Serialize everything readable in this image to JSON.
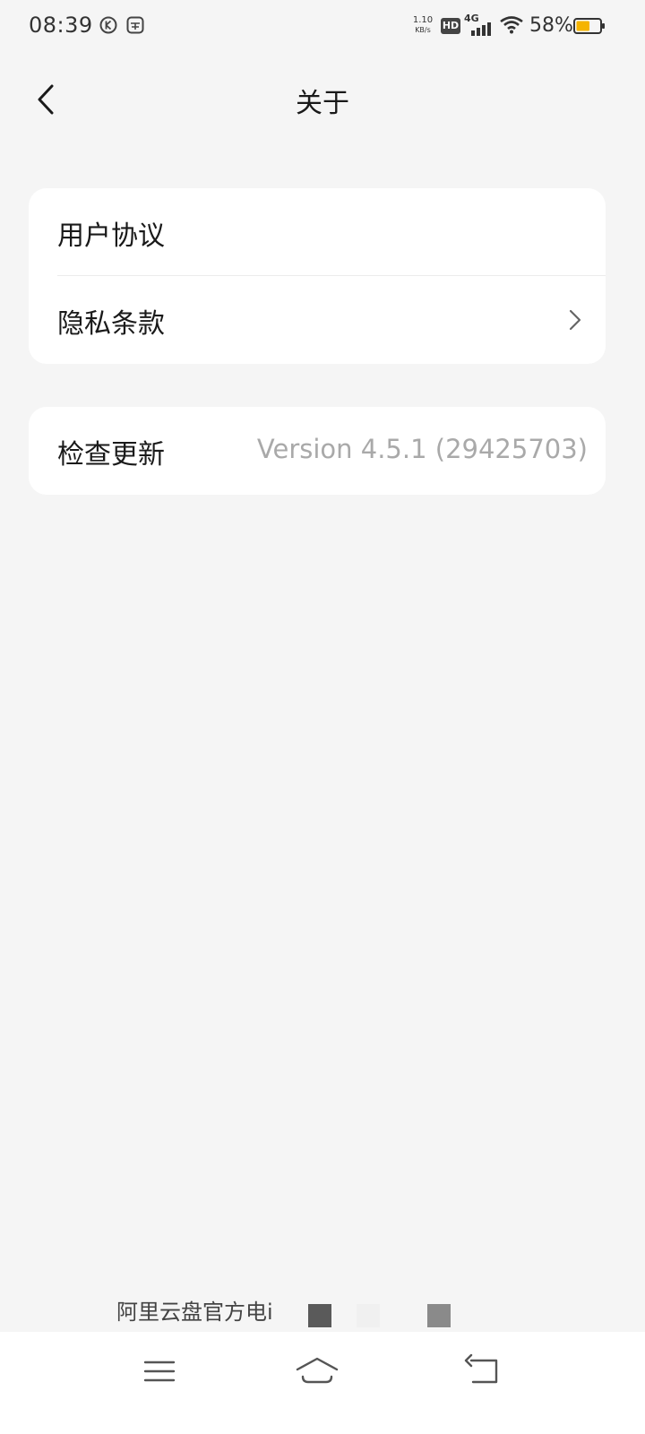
{
  "status_bar": {
    "time": "08:39",
    "net_speed_value": "1.10",
    "net_speed_unit": "KB/s",
    "hd_label": "HD",
    "network_type": "4G",
    "battery_percent": "58%",
    "battery_level": 0.58,
    "battery_color": "#f5b400"
  },
  "header": {
    "title": "关于"
  },
  "settings_group_1": [
    {
      "label": "用户协议"
    },
    {
      "label": "隐私条款"
    }
  ],
  "settings_group_2": {
    "label": "检查更新",
    "version": "Version 4.5.1 (29425703)"
  },
  "footer": {
    "text": "阿里云盘官方电i"
  },
  "colors": {
    "background": "#f5f5f5",
    "card": "#ffffff",
    "secondary_text": "#a9a9a9"
  }
}
